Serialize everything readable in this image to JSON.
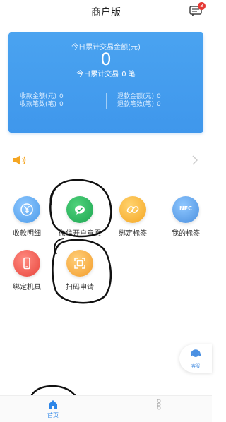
{
  "header": {
    "title": "商户版",
    "message_badge": "3"
  },
  "card": {
    "today_amount_label": "今日累计交易金额(元)",
    "today_amount_value": "0",
    "today_count_label": "今日累计交易",
    "today_count_value": "0",
    "today_count_unit": "笔",
    "left_stats": [
      {
        "label": "收款金额(元)",
        "value": "0"
      },
      {
        "label": "收款笔数(笔)",
        "value": "0"
      }
    ],
    "right_stats": [
      {
        "label": "退款金额(元)",
        "value": "0"
      },
      {
        "label": "退款笔数(笔)",
        "value": "0"
      }
    ]
  },
  "grid": [
    {
      "label": "收款明细",
      "icon": "yen-icon"
    },
    {
      "label": "微信开户意愿",
      "icon": "wechat-icon"
    },
    {
      "label": "绑定标签",
      "icon": "link-icon"
    },
    {
      "label": "我的标签",
      "icon": "nfc-icon",
      "icon_text": "NFC"
    },
    {
      "label": "绑定机具",
      "icon": "phone-icon"
    },
    {
      "label": "扫码申请",
      "icon": "scan-icon"
    }
  ],
  "service": {
    "label": "客服"
  },
  "tabbar": {
    "home_label": "首页",
    "more_label": ""
  },
  "colors": {
    "card_blue": "#4aa3f0",
    "accent_blue": "#2d86e8",
    "badge_red": "#e53935"
  }
}
